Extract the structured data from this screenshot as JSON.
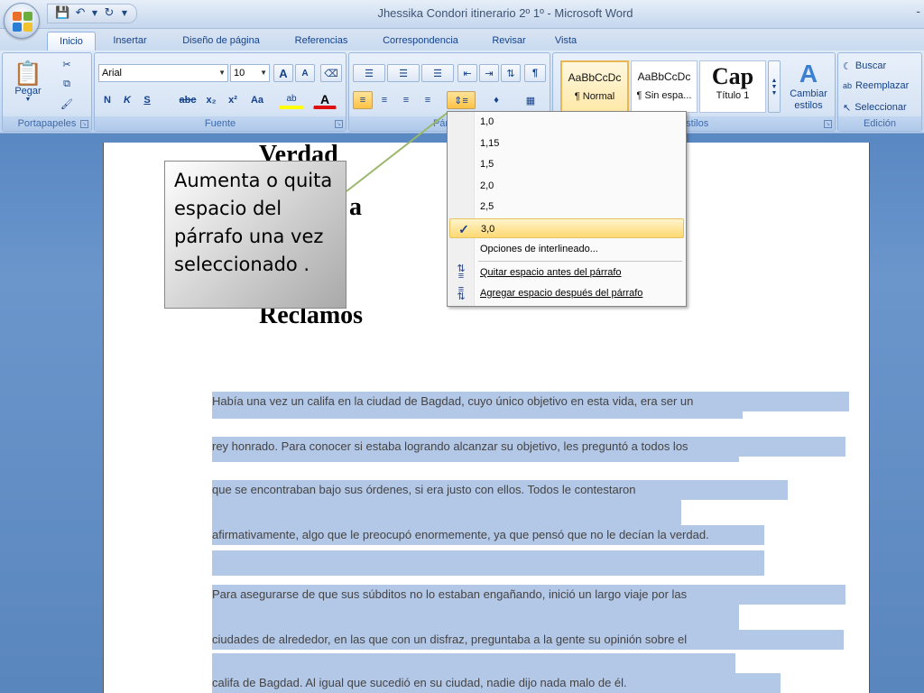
{
  "window": {
    "title": "Jhessika Condori itinerario 2º 1º - Microsoft Word",
    "title_right": "-"
  },
  "tabs": [
    {
      "label": "Inicio",
      "active": true
    },
    {
      "label": "Insertar"
    },
    {
      "label": "Diseño de página"
    },
    {
      "label": "Referencias"
    },
    {
      "label": "Correspondencia"
    },
    {
      "label": "Revisar"
    },
    {
      "label": "Vista"
    }
  ],
  "clipboard": {
    "label": "Portapapeles",
    "paste_label": "Pegar"
  },
  "font": {
    "label": "Fuente",
    "font_name": "Arial",
    "font_size": "10",
    "grow_label": "A",
    "shrink_label": "A",
    "bold_label": "N",
    "italic_label": "K",
    "underline_label": "S",
    "strike_label": "abc",
    "subscript_label": "x₂",
    "superscript_label": "x²",
    "case_label": "Aa",
    "highlight_label": "ab",
    "color_label": "A"
  },
  "paragraph": {
    "label": "Párrafo",
    "pilcrow": "¶"
  },
  "styles": {
    "label": "Estilos",
    "items": [
      {
        "sample": "AaBbCcDc",
        "name": "¶ Normal",
        "selected": true
      },
      {
        "sample": "AaBbCcDc",
        "name": "¶ Sin espa..."
      },
      {
        "sample": "Cap",
        "name": "Título 1"
      }
    ],
    "change_label": "Cambiar",
    "change_label2": "estilos"
  },
  "editing": {
    "label": "Edición",
    "find_label": "Buscar",
    "replace_label": "Reemplazar",
    "select_label": "Seleccionar"
  },
  "spacing_menu": {
    "options": [
      {
        "label": "1,0"
      },
      {
        "label": "1,15"
      },
      {
        "label": "1,5"
      },
      {
        "label": "2,0"
      },
      {
        "label": "2,5"
      },
      {
        "label": "3,0",
        "checked": true
      }
    ],
    "more_options": "Opciones de interlineado...",
    "remove_before": "Quitar espacio antes del párrafo",
    "add_after": "Agregar espacio después del párrafo",
    "check_mark": "✓"
  },
  "callout": {
    "text": "Aumenta o quita espacio del párrafo una vez seleccionado ."
  },
  "document": {
    "title_line1": "Verdad",
    "title_line2_partial": "a",
    "title_line3": "Reclamos",
    "lines": [
      "Había una vez un califa en la ciudad de Bagdad, cuyo único objetivo en esta vida, era ser un",
      "rey honrado. Para conocer si estaba logrando alcanzar su objetivo, les preguntó a todos los",
      "que se encontraban bajo sus órdenes, si era justo con ellos. Todos le contestaron",
      "afirmativamente, algo que le preocupó enormemente, ya que pensó que no le decían la verdad.",
      "Para asegurarse de que sus súbditos no lo estaban engañando, inició un largo viaje por las",
      "ciudades de alrededor, en las que con un disfraz, preguntaba a la gente su opinión sobre el",
      "califa de Bagdad. Al igual que sucedió en su ciudad, nadie dijo nada malo de él."
    ]
  },
  "colors": {
    "selection": "#b3c7e6",
    "ribbon_text": "#15428b",
    "menu_highlight": "#ffd972"
  }
}
